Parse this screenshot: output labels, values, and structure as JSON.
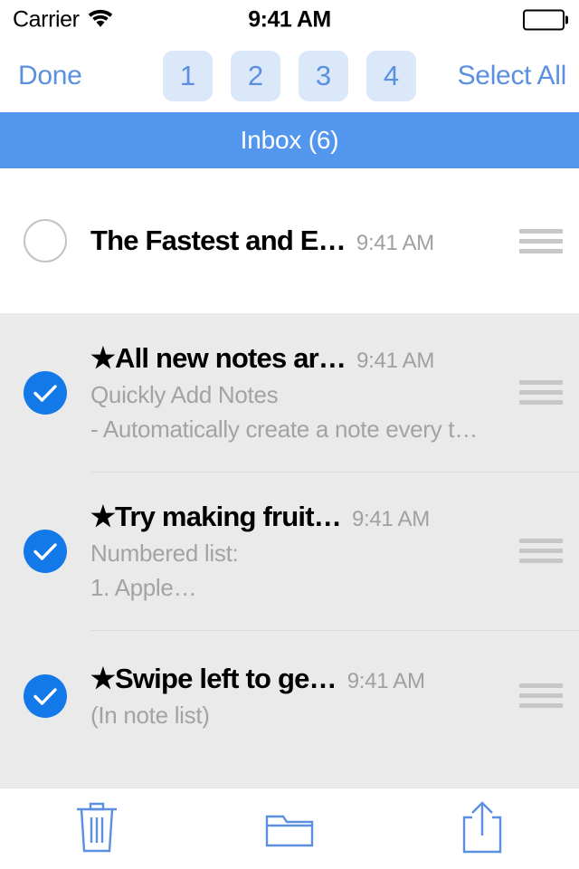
{
  "status_bar": {
    "carrier": "Carrier",
    "wifi_icon": "wifi-icon",
    "time": "9:41 AM",
    "battery_icon": "battery-full-icon"
  },
  "nav_bar": {
    "done_label": "Done",
    "select_all_label": "Select All",
    "number_buttons": [
      {
        "label": "1"
      },
      {
        "label": "2"
      },
      {
        "label": "3"
      },
      {
        "label": "4"
      }
    ]
  },
  "section_header": {
    "title": "Inbox (6)"
  },
  "list": {
    "rows": [
      {
        "selected": false,
        "title": "The Fastest and E…",
        "time": "9:41 AM",
        "preview1": "",
        "preview2": ""
      },
      {
        "selected": true,
        "title": "★All new notes ar…",
        "time": "9:41 AM",
        "preview1": "Quickly Add Notes",
        "preview2": "- Automatically create a note every t…"
      },
      {
        "selected": true,
        "title": "★Try making fruit…",
        "time": "9:41 AM",
        "preview1": "Numbered list:",
        "preview2": "1. Apple…"
      },
      {
        "selected": true,
        "title": "★Swipe left to ge…",
        "time": "9:41 AM",
        "preview1": "(In note list)",
        "preview2": ""
      }
    ]
  },
  "toolbar": {
    "delete_icon": "trash-icon",
    "move_icon": "folder-icon",
    "share_icon": "share-icon"
  },
  "colors": {
    "accent_blue": "#5b90e0",
    "header_blue": "#5396ee",
    "check_blue": "#1479e8",
    "number_btn_bg": "#dbe8fa",
    "selected_row_bg": "#eaeaea",
    "muted_text": "#a3a3a3"
  }
}
